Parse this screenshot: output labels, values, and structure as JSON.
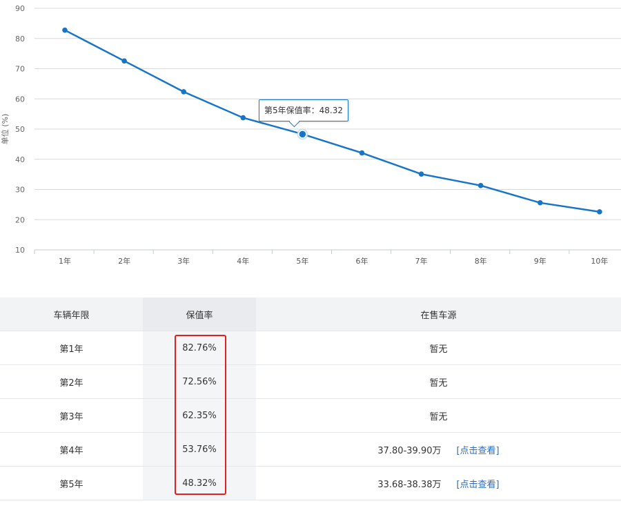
{
  "chart_data": {
    "type": "line",
    "ylabel": "单位 (%)",
    "categories": [
      "1年",
      "2年",
      "3年",
      "4年",
      "5年",
      "6年",
      "7年",
      "8年",
      "9年",
      "10年"
    ],
    "values": [
      82.76,
      72.56,
      62.35,
      53.76,
      48.32,
      42.1,
      35.1,
      31.3,
      25.6,
      22.6
    ],
    "ylim": [
      10,
      90
    ],
    "yticks": [
      10,
      20,
      30,
      40,
      50,
      60,
      70,
      80,
      90
    ],
    "grid": true,
    "highlighted_index": 4,
    "colors": {
      "line": "#1775c9",
      "grid": "#d9d9d9",
      "axis": "#c6cbd2"
    }
  },
  "tooltip": {
    "label": "第5年保值率：",
    "value": "48.32"
  },
  "table": {
    "headers": [
      "车辆年限",
      "保值率",
      "在售车源"
    ],
    "rows": [
      {
        "year": "第1年",
        "rate": "82.76%",
        "price": "",
        "source": "暂无",
        "link": ""
      },
      {
        "year": "第2年",
        "rate": "72.56%",
        "price": "",
        "source": "暂无",
        "link": ""
      },
      {
        "year": "第3年",
        "rate": "62.35%",
        "price": "",
        "source": "暂无",
        "link": ""
      },
      {
        "year": "第4年",
        "rate": "53.76%",
        "price": "37.80-39.90万",
        "source": "",
        "link": "[点击查看]"
      },
      {
        "year": "第5年",
        "rate": "48.32%",
        "price": "33.68-38.38万",
        "source": "",
        "link": "[点击查看]"
      }
    ]
  }
}
